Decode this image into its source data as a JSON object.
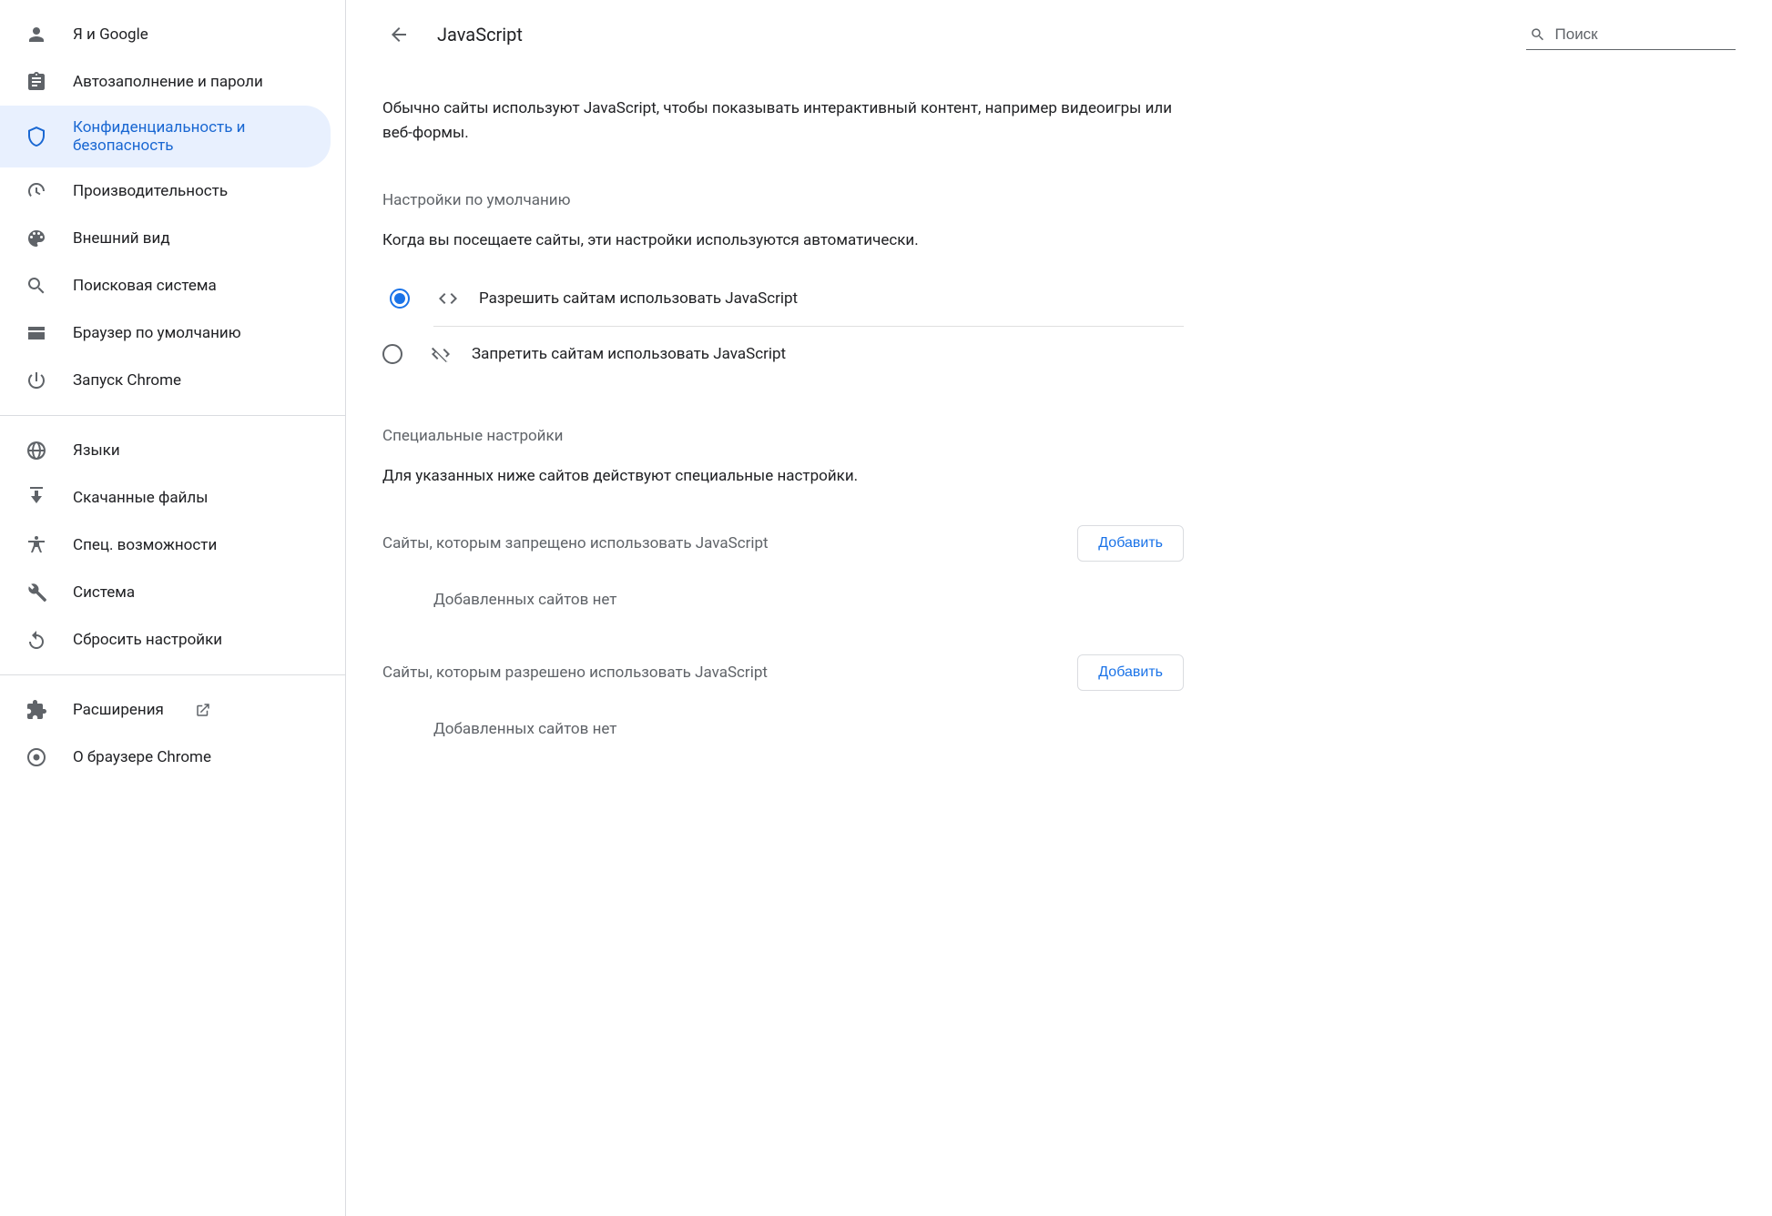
{
  "sidebar": {
    "items": [
      {
        "label": "Я и Google",
        "icon": "person-icon"
      },
      {
        "label": "Автозаполнение и пароли",
        "icon": "clipboard-icon"
      },
      {
        "label": "Конфиденциальность и безопасность",
        "icon": "shield-icon",
        "selected": true
      },
      {
        "label": "Производительность",
        "icon": "speedometer-icon"
      },
      {
        "label": "Внешний вид",
        "icon": "palette-icon"
      },
      {
        "label": "Поисковая система",
        "icon": "search-icon"
      },
      {
        "label": "Браузер по умолчанию",
        "icon": "browser-icon"
      },
      {
        "label": "Запуск Chrome",
        "icon": "power-icon"
      }
    ],
    "items2": [
      {
        "label": "Языки",
        "icon": "globe-icon"
      },
      {
        "label": "Скачанные файлы",
        "icon": "download-icon"
      },
      {
        "label": "Спец. возможности",
        "icon": "accessibility-icon"
      },
      {
        "label": "Система",
        "icon": "wrench-icon"
      },
      {
        "label": "Сбросить настройки",
        "icon": "reset-icon"
      }
    ],
    "items3": [
      {
        "label": "Расширения",
        "icon": "extension-icon",
        "external": true
      },
      {
        "label": "О браузере Chrome",
        "icon": "chrome-icon"
      }
    ]
  },
  "header": {
    "title": "JavaScript",
    "search_placeholder": "Поиск"
  },
  "content": {
    "description": "Обычно сайты используют JavaScript, чтобы показывать интерактивный контент, например видеоигры или веб-формы.",
    "default_section_title": "Настройки по умолчанию",
    "default_section_sub": "Когда вы посещаете сайты, эти настройки используются автоматически.",
    "radio_allow": "Разрешить сайтам использовать JavaScript",
    "radio_block": "Запретить сайтам использовать JavaScript",
    "custom_section_title": "Специальные настройки",
    "custom_section_sub": "Для указанных ниже сайтов действуют специальные настройки.",
    "blocked_sites_title": "Сайты, которым запрещено использовать JavaScript",
    "allowed_sites_title": "Сайты, которым разрешено использовать JavaScript",
    "add_button": "Добавить",
    "empty_list": "Добавленных сайтов нет"
  }
}
